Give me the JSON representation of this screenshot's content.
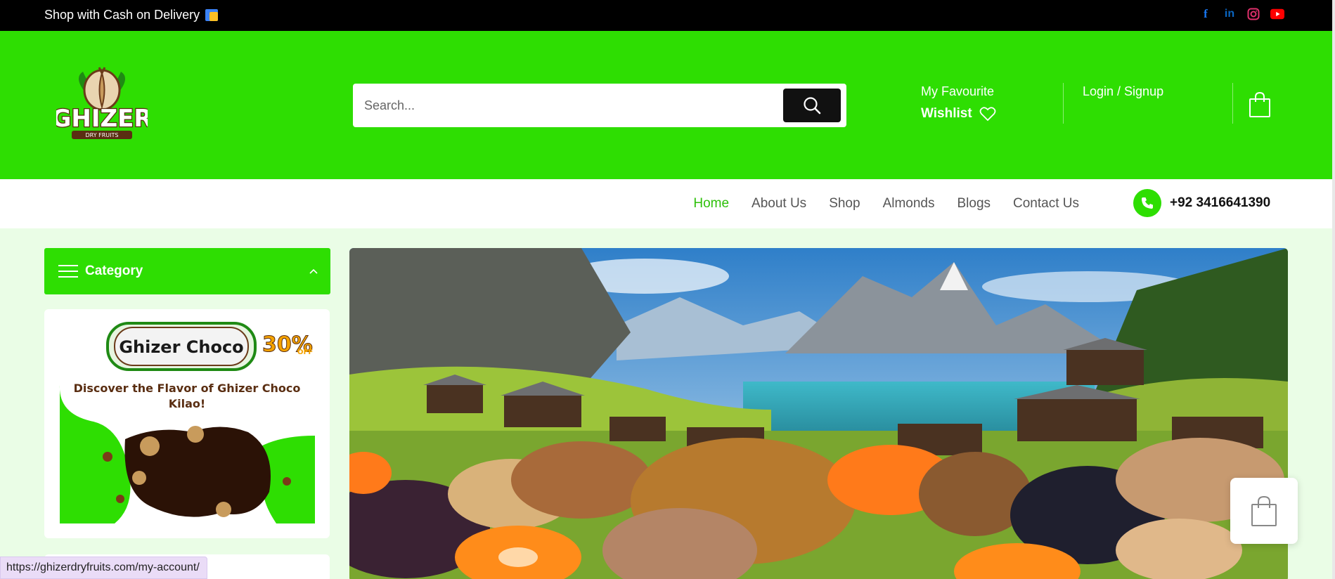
{
  "topbar": {
    "promo_text": "Shop with Cash on Delivery",
    "socials": [
      {
        "icon": "facebook-icon",
        "glyph": "f",
        "color": "#1877f2"
      },
      {
        "icon": "linkedin-icon",
        "glyph": "in",
        "color": "#0a66c2"
      },
      {
        "icon": "instagram-icon",
        "glyph": "◎",
        "color": "#e1306c"
      },
      {
        "icon": "youtube-icon",
        "glyph": "▶",
        "color": "#ff0000"
      }
    ]
  },
  "header": {
    "logo_text": "GHIZER",
    "logo_subtext": "DRY FRUITS",
    "search_placeholder": "Search...",
    "fav_line1": "My Favourite",
    "fav_line2": "Wishlist",
    "login_label": "Login / Signup"
  },
  "nav": {
    "items": [
      "Home",
      "About Us",
      "Shop",
      "Almonds",
      "Blogs",
      "Contact Us"
    ],
    "active": "Home",
    "phone": "+92 3416641390"
  },
  "sidebar": {
    "category_title": "Category",
    "promo_brand": "Ghizer Choco",
    "promo_badge": "30%",
    "promo_badge_sub": "OFF",
    "promo_line": "Discover the Flavor of Ghizer Choco Kilao!"
  },
  "status_url": "https://ghizerdryfruits.com/my-account/",
  "colors": {
    "brand_green": "#2ede02",
    "topbar_bg": "#000000",
    "page_bg": "#eafde6"
  }
}
